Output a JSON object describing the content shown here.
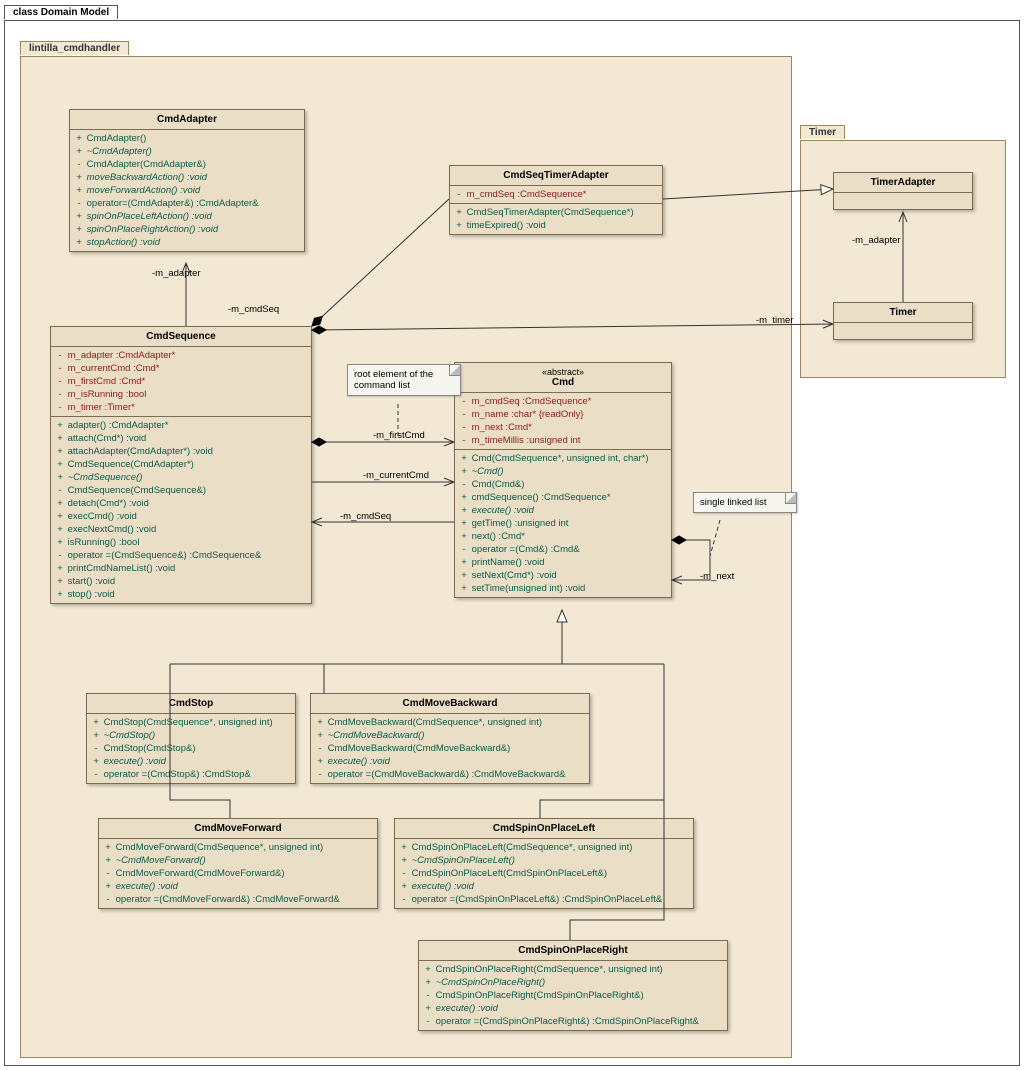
{
  "diagram_title": "class Domain Model",
  "package_main": "lintilla_cmdhandler",
  "package_timer": "Timer",
  "notes": {
    "root_list": "root element of the command list",
    "single_list": "single linked list"
  },
  "edge_labels": {
    "m_adapter": "-m_adapter",
    "m_cmdSeq1": "-m_cmdSeq",
    "m_cmdSeq2": "-m_cmdSeq",
    "m_firstCmd": "-m_firstCmd",
    "m_currentCmd": "-m_currentCmd",
    "m_timer": "-m_timer",
    "m_adapter_timer": "-m_adapter",
    "m_next": "-m_next"
  },
  "classes": {
    "CmdAdapter": {
      "title": "CmdAdapter",
      "ops": [
        {
          "v": "+",
          "t": "CmdAdapter()"
        },
        {
          "v": "+",
          "t": "~CmdAdapter()",
          "it": true
        },
        {
          "v": "-",
          "t": "CmdAdapter(CmdAdapter&)"
        },
        {
          "v": "+",
          "t": "moveBackwardAction()  :void",
          "it": true
        },
        {
          "v": "+",
          "t": "moveForwardAction()  :void",
          "it": true
        },
        {
          "v": "-",
          "t": "operator=(CmdAdapter&)  :CmdAdapter&"
        },
        {
          "v": "+",
          "t": "spinOnPlaceLeftAction()  :void",
          "it": true
        },
        {
          "v": "+",
          "t": "spinOnPlaceRightAction()  :void",
          "it": true
        },
        {
          "v": "+",
          "t": "stopAction()  :void",
          "it": true
        }
      ]
    },
    "CmdSeqTimerAdapter": {
      "title": "CmdSeqTimerAdapter",
      "attrs": [
        {
          "v": "-",
          "t": "m_cmdSeq  :CmdSequence*"
        }
      ],
      "ops": [
        {
          "v": "+",
          "t": "CmdSeqTimerAdapter(CmdSequence*)"
        },
        {
          "v": "+",
          "t": "timeExpired()  :void"
        }
      ]
    },
    "TimerAdapter": {
      "title": "TimerAdapter"
    },
    "Timer": {
      "title": "Timer"
    },
    "CmdSequence": {
      "title": "CmdSequence",
      "attrs": [
        {
          "v": "-",
          "t": "m_adapter  :CmdAdapter*"
        },
        {
          "v": "-",
          "t": "m_currentCmd  :Cmd*"
        },
        {
          "v": "-",
          "t": "m_firstCmd  :Cmd*"
        },
        {
          "v": "-",
          "t": "m_isRunning  :bool"
        },
        {
          "v": "-",
          "t": "m_timer  :Timer*"
        }
      ],
      "ops": [
        {
          "v": "+",
          "t": "adapter()  :CmdAdapter*"
        },
        {
          "v": "+",
          "t": "attach(Cmd*)  :void"
        },
        {
          "v": "+",
          "t": "attachAdapter(CmdAdapter*)  :void"
        },
        {
          "v": "+",
          "t": "CmdSequence(CmdAdapter*)"
        },
        {
          "v": "+",
          "t": "~CmdSequence()",
          "it": true
        },
        {
          "v": "-",
          "t": "CmdSequence(CmdSequence&)"
        },
        {
          "v": "+",
          "t": "detach(Cmd*)  :void"
        },
        {
          "v": "+",
          "t": "execCmd()  :void"
        },
        {
          "v": "+",
          "t": "execNextCmd()  :void"
        },
        {
          "v": "+",
          "t": "isRunning()  :bool"
        },
        {
          "v": "-",
          "t": "operator =(CmdSequence&)  :CmdSequence&"
        },
        {
          "v": "+",
          "t": "printCmdNameList()  :void"
        },
        {
          "v": "+",
          "t": "start()  :void"
        },
        {
          "v": "+",
          "t": "stop()  :void"
        }
      ]
    },
    "Cmd": {
      "stereo": "«abstract»",
      "title": "Cmd",
      "attrs": [
        {
          "v": "-",
          "t": "m_cmdSeq  :CmdSequence*"
        },
        {
          "v": "-",
          "t": "m_name  :char* {readOnly}"
        },
        {
          "v": "-",
          "t": "m_next  :Cmd*"
        },
        {
          "v": "-",
          "t": "m_timeMillis  :unsigned int"
        }
      ],
      "ops": [
        {
          "v": "+",
          "t": "Cmd(CmdSequence*, unsigned int, char*)"
        },
        {
          "v": "+",
          "t": "~Cmd()",
          "it": true
        },
        {
          "v": "-",
          "t": "Cmd(Cmd&)"
        },
        {
          "v": "+",
          "t": "cmdSequence()  :CmdSequence*"
        },
        {
          "v": "+",
          "t": "execute()  :void",
          "it": true
        },
        {
          "v": "+",
          "t": "getTime()  :unsigned int"
        },
        {
          "v": "+",
          "t": "next()  :Cmd*"
        },
        {
          "v": "-",
          "t": "operator =(Cmd&)  :Cmd&"
        },
        {
          "v": "+",
          "t": "printName()  :void"
        },
        {
          "v": "+",
          "t": "setNext(Cmd*)  :void"
        },
        {
          "v": "+",
          "t": "setTime(unsigned int)  :void"
        }
      ]
    },
    "CmdStop": {
      "title": "CmdStop",
      "ops": [
        {
          "v": "+",
          "t": "CmdStop(CmdSequence*, unsigned int)"
        },
        {
          "v": "+",
          "t": "~CmdStop()",
          "it": true
        },
        {
          "v": "-",
          "t": "CmdStop(CmdStop&)"
        },
        {
          "v": "+",
          "t": "execute()  :void",
          "it": true
        },
        {
          "v": "-",
          "t": "operator =(CmdStop&)  :CmdStop&"
        }
      ]
    },
    "CmdMoveBackward": {
      "title": "CmdMoveBackward",
      "ops": [
        {
          "v": "+",
          "t": "CmdMoveBackward(CmdSequence*, unsigned int)"
        },
        {
          "v": "+",
          "t": "~CmdMoveBackward()",
          "it": true
        },
        {
          "v": "-",
          "t": "CmdMoveBackward(CmdMoveBackward&)"
        },
        {
          "v": "+",
          "t": "execute()  :void",
          "it": true
        },
        {
          "v": "-",
          "t": "operator =(CmdMoveBackward&)  :CmdMoveBackward&"
        }
      ]
    },
    "CmdMoveForward": {
      "title": "CmdMoveForward",
      "ops": [
        {
          "v": "+",
          "t": "CmdMoveForward(CmdSequence*, unsigned int)"
        },
        {
          "v": "+",
          "t": "~CmdMoveForward()",
          "it": true
        },
        {
          "v": "-",
          "t": "CmdMoveForward(CmdMoveForward&)"
        },
        {
          "v": "+",
          "t": "execute()  :void",
          "it": true
        },
        {
          "v": "-",
          "t": "operator =(CmdMoveForward&)  :CmdMoveForward&"
        }
      ]
    },
    "CmdSpinOnPlaceLeft": {
      "title": "CmdSpinOnPlaceLeft",
      "ops": [
        {
          "v": "+",
          "t": "CmdSpinOnPlaceLeft(CmdSequence*, unsigned int)"
        },
        {
          "v": "+",
          "t": "~CmdSpinOnPlaceLeft()",
          "it": true
        },
        {
          "v": "-",
          "t": "CmdSpinOnPlaceLeft(CmdSpinOnPlaceLeft&)"
        },
        {
          "v": "+",
          "t": "execute()  :void",
          "it": true
        },
        {
          "v": "-",
          "t": "operator =(CmdSpinOnPlaceLeft&)  :CmdSpinOnPlaceLeft&"
        }
      ]
    },
    "CmdSpinOnPlaceRight": {
      "title": "CmdSpinOnPlaceRight",
      "ops": [
        {
          "v": "+",
          "t": "CmdSpinOnPlaceRight(CmdSequence*, unsigned int)"
        },
        {
          "v": "+",
          "t": "~CmdSpinOnPlaceRight()",
          "it": true
        },
        {
          "v": "-",
          "t": "CmdSpinOnPlaceRight(CmdSpinOnPlaceRight&)"
        },
        {
          "v": "+",
          "t": "execute()  :void",
          "it": true
        },
        {
          "v": "-",
          "t": "operator =(CmdSpinOnPlaceRight&)  :CmdSpinOnPlaceRight&"
        }
      ]
    }
  }
}
